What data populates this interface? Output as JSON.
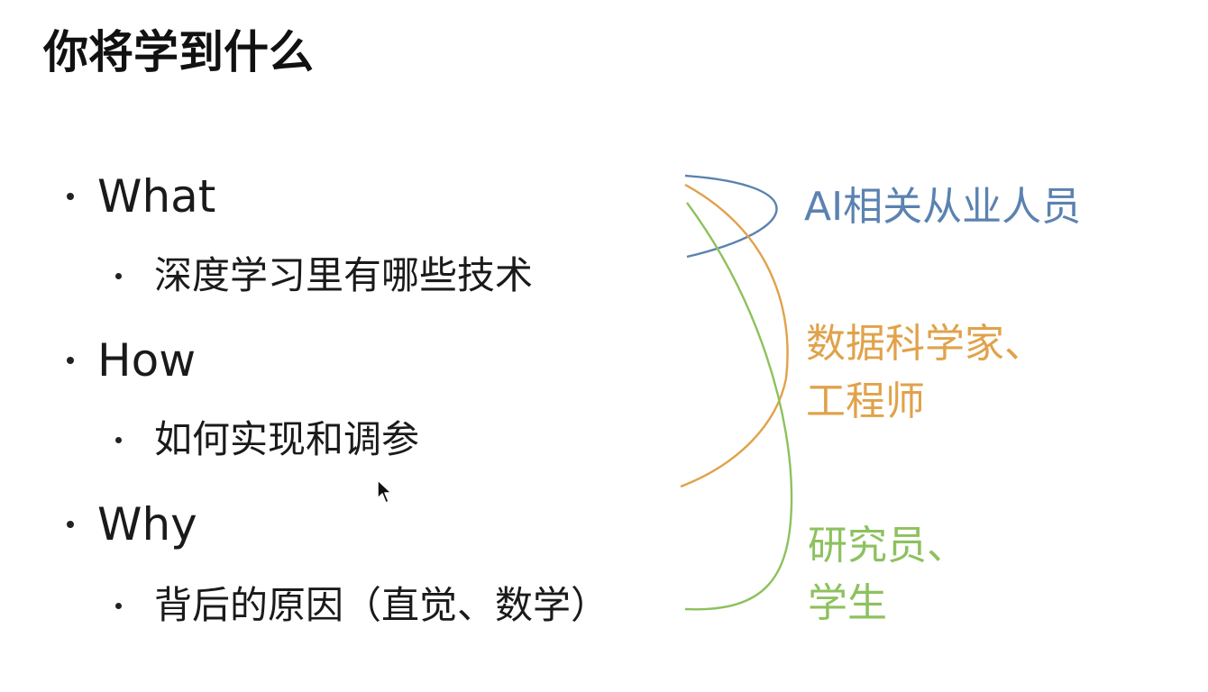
{
  "slide": {
    "title": "你将学到什么",
    "bullets": [
      {
        "label": "What",
        "sub": "深度学习里有哪些技术"
      },
      {
        "label": "How",
        "sub": "如何实现和调参"
      },
      {
        "label": "Why",
        "sub": "背后的原因（直觉、数学）"
      }
    ],
    "annotations": [
      {
        "lines": [
          "AI相关从业人员"
        ],
        "color": "#5B82B0"
      },
      {
        "lines": [
          "数据科学家、",
          "工程师"
        ],
        "color": "#E0A24A"
      },
      {
        "lines": [
          "研究员、",
          "学生"
        ],
        "color": "#8DC15E"
      }
    ]
  },
  "icons": {
    "cursor": "mouse-pointer-icon"
  }
}
